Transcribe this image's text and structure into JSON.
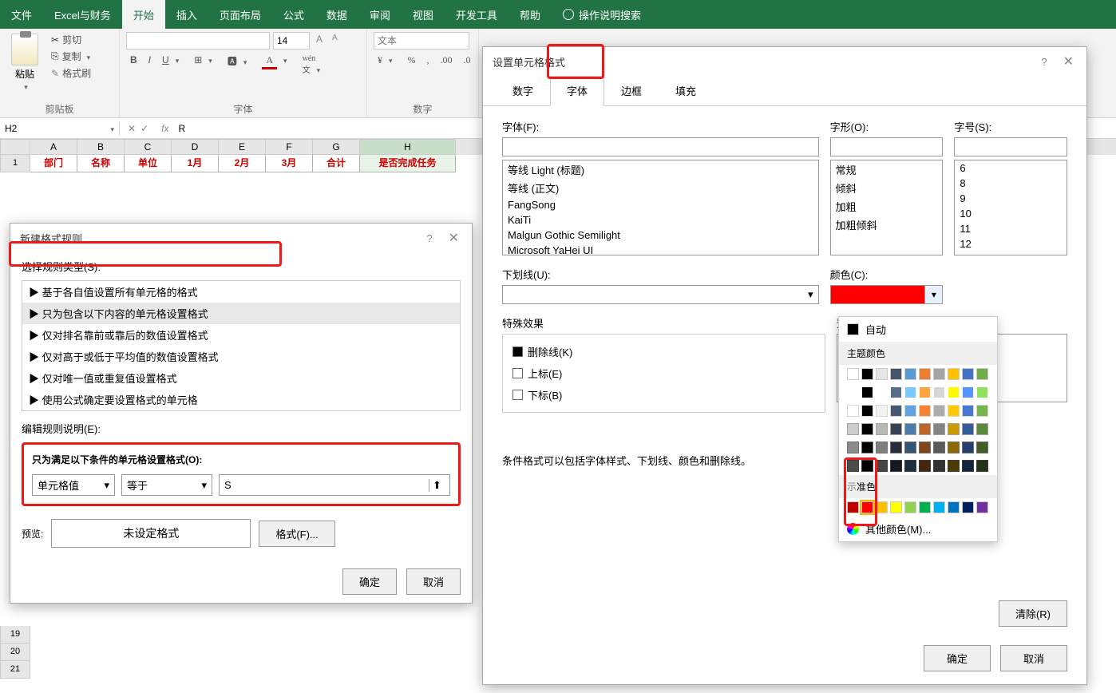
{
  "ribbon": {
    "tabs": [
      "文件",
      "Excel与财务",
      "开始",
      "插入",
      "页面布局",
      "公式",
      "数据",
      "审阅",
      "视图",
      "开发工具",
      "帮助"
    ],
    "active": 2,
    "tell_me": "操作说明搜索",
    "clipboard": {
      "label": "剪贴板",
      "paste": "粘贴",
      "cut": "剪切",
      "copy": "复制",
      "brush": "格式刷"
    },
    "font": {
      "label": "字体",
      "size": "14"
    },
    "number": {
      "label": "数字",
      "placeholder": "文本"
    }
  },
  "namebox": "H2",
  "formula": "R",
  "headers": [
    "A",
    "B",
    "C",
    "D",
    "E",
    "F",
    "G",
    "H"
  ],
  "row1": [
    "部门",
    "名称",
    "单位",
    "1月",
    "2月",
    "3月",
    "合计",
    "是否完成任务"
  ],
  "rows_rest": [
    "19",
    "20",
    "21"
  ],
  "dlg1": {
    "title": "新建格式规则",
    "sel_type": "选择规则类型(S):",
    "rules": [
      "基于各自值设置所有单元格的格式",
      "只为包含以下内容的单元格设置格式",
      "仅对排名靠前或靠后的数值设置格式",
      "仅对高于或低于平均值的数值设置格式",
      "仅对唯一值或重复值设置格式",
      "使用公式确定要设置格式的单元格"
    ],
    "rule_sel": 1,
    "edit_desc": "编辑规则说明(E):",
    "cond_label": "只为满足以下条件的单元格设置格式(O):",
    "cond_target": "单元格值",
    "cond_op": "等于",
    "cond_val": "S",
    "preview_label": "预览:",
    "preview_text": "未设定格式",
    "format_btn": "格式(F)...",
    "ok": "确定",
    "cancel": "取消"
  },
  "dlg2": {
    "title": "设置单元格格式",
    "tabs": [
      "数字",
      "字体",
      "边框",
      "填充"
    ],
    "tab_active": 1,
    "font_label": "字体(F):",
    "style_label": "字形(O):",
    "size_label": "字号(S):",
    "fonts": [
      "等线 Light (标题)",
      "等线 (正文)",
      "FangSong",
      "KaiTi",
      "Malgun Gothic Semilight",
      "Microsoft YaHei UI"
    ],
    "styles": [
      "常规",
      "倾斜",
      "加粗",
      "加粗倾斜"
    ],
    "sizes": [
      "6",
      "8",
      "9",
      "10",
      "11",
      "12"
    ],
    "underline_label": "下划线(U):",
    "color_label": "颜色(C):",
    "effects_label": "特殊效果",
    "strike": "删除线(K)",
    "sup": "上标(E)",
    "sub": "下标(B)",
    "preview_label": "预览",
    "note": "条件格式可以包括字体样式、下划线、颜色和删除线。",
    "clear": "清除(R)",
    "ok": "确定",
    "cancel": "取消"
  },
  "color_pop": {
    "auto": "自动",
    "theme": "主题颜色",
    "standard": "标准色",
    "more": "其他颜色(M)...",
    "theme_row1": [
      "#ffffff",
      "#000000",
      "#e7e6e6",
      "#44546a",
      "#5b9bd5",
      "#ed7d31",
      "#a5a5a5",
      "#ffc000",
      "#4472c4",
      "#70ad47"
    ],
    "std": [
      "#c00000",
      "#ff0000",
      "#ffc000",
      "#ffff00",
      "#92d050",
      "#00b050",
      "#00b0f0",
      "#0070c0",
      "#002060",
      "#7030a0"
    ]
  }
}
